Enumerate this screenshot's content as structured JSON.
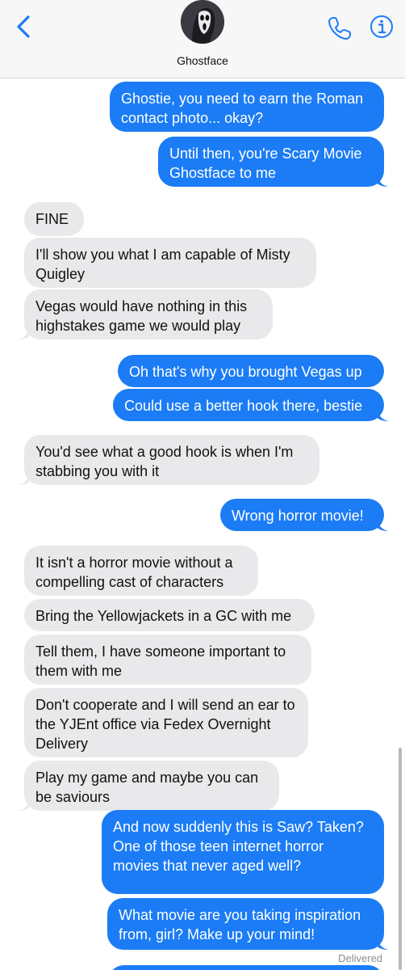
{
  "header": {
    "contact_name": "Ghostface",
    "back_icon": "chevron-left-icon",
    "call_icon": "phone-icon",
    "info_icon": "info-icon"
  },
  "colors": {
    "outgoing": "#1b7cf5",
    "incoming": "#e9e9eb",
    "accent": "#1b7cf5"
  },
  "messages": [
    {
      "dir": "out",
      "text": "Ghostie, you need to earn the Roman contact photo... okay?"
    },
    {
      "dir": "out",
      "text": "Until then, you're Scary Movie Ghostface to me"
    },
    {
      "dir": "in",
      "text": "FINE"
    },
    {
      "dir": "in",
      "text": "I'll show you what I am capable of Misty Quigley"
    },
    {
      "dir": "in",
      "text": "Vegas would have nothing in this highstakes game we would play"
    },
    {
      "dir": "out",
      "text": "Oh that's why you brought Vegas up"
    },
    {
      "dir": "out",
      "text": "Could use a better hook there, bestie"
    },
    {
      "dir": "in",
      "text": "You'd see what a good hook is when I'm stabbing you with it"
    },
    {
      "dir": "out",
      "text": "Wrong horror movie!"
    },
    {
      "dir": "in",
      "text": "It isn't a horror movie without a compelling cast of characters"
    },
    {
      "dir": "in",
      "text": "Bring the Yellowjackets in a GC with me"
    },
    {
      "dir": "in",
      "text": "Tell them, I have someone important to them with me"
    },
    {
      "dir": "in",
      "text": "Don't cooperate and I will send an ear to the YJEnt office via Fedex Overnight Delivery"
    },
    {
      "dir": "in",
      "text": "Play my game and maybe you can be saviours"
    },
    {
      "dir": "out",
      "text": "And now suddenly this is Saw? Taken? One of those teen internet horror movies that never aged well?"
    },
    {
      "dir": "out",
      "text": "What movie are you taking inspiration from, girl? Make up your mind!"
    }
  ],
  "status": {
    "delivered": "Delivered"
  }
}
